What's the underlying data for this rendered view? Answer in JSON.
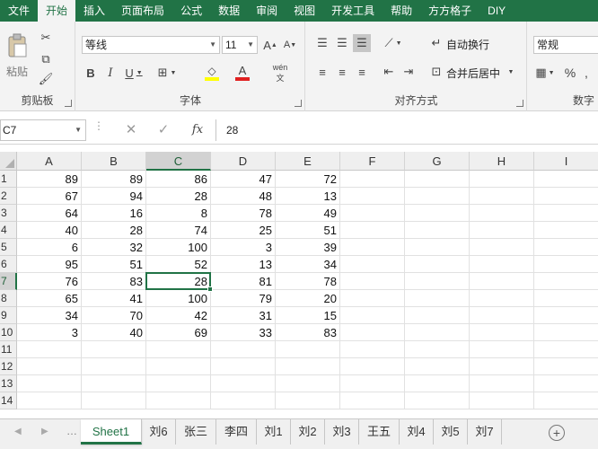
{
  "ribbon_tabs": [
    "文件",
    "开始",
    "插入",
    "页面布局",
    "公式",
    "数据",
    "审阅",
    "视图",
    "开发工具",
    "帮助",
    "方方格子",
    "DIY"
  ],
  "active_tab": "开始",
  "clipboard": {
    "paste_label": "粘贴",
    "group_label": "剪贴板"
  },
  "font": {
    "name": "等线",
    "size": "11",
    "group_label": "字体",
    "phonetic_label": "wén"
  },
  "alignment": {
    "wrap_label": "自动换行",
    "merge_label": "合并后居中",
    "group_label": "对齐方式"
  },
  "number": {
    "format": "常规",
    "group_label": "数字"
  },
  "formula_bar": {
    "name_box": "C7",
    "value": "28"
  },
  "columns": [
    "A",
    "B",
    "C",
    "D",
    "E",
    "F",
    "G",
    "H",
    "I"
  ],
  "selected_column": "C",
  "rows": [
    "1",
    "2",
    "3",
    "4",
    "5",
    "6",
    "7",
    "8",
    "9",
    "10",
    "11",
    "12",
    "13",
    "14"
  ],
  "selected_row": "7",
  "cells": [
    [
      "89",
      "89",
      "86",
      "47",
      "72"
    ],
    [
      "67",
      "94",
      "28",
      "48",
      "13"
    ],
    [
      "64",
      "16",
      "8",
      "78",
      "49"
    ],
    [
      "40",
      "28",
      "74",
      "25",
      "51"
    ],
    [
      "6",
      "32",
      "100",
      "3",
      "39"
    ],
    [
      "95",
      "51",
      "52",
      "13",
      "34"
    ],
    [
      "76",
      "83",
      "28",
      "81",
      "78"
    ],
    [
      "65",
      "41",
      "100",
      "79",
      "20"
    ],
    [
      "34",
      "70",
      "42",
      "31",
      "15"
    ],
    [
      "3",
      "40",
      "69",
      "33",
      "83"
    ]
  ],
  "sheets": [
    "Sheet1",
    "刘6",
    "张三",
    "李四",
    "刘1",
    "刘2",
    "刘3",
    "王五",
    "刘4",
    "刘5",
    "刘7"
  ],
  "active_sheet": "Sheet1",
  "colors": {
    "accent": "#217346"
  }
}
